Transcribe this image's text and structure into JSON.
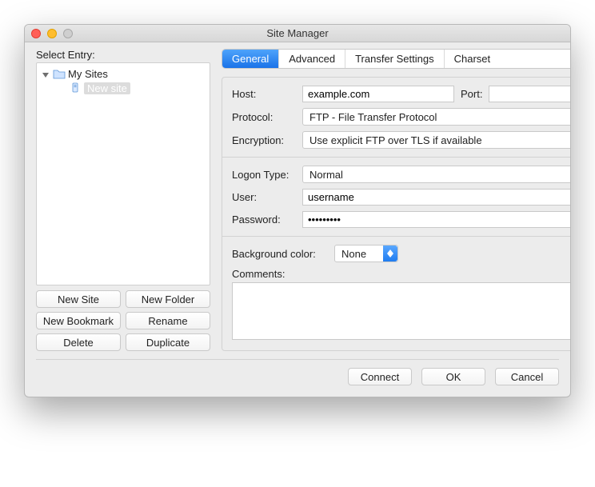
{
  "window_title": "Site Manager",
  "left": {
    "section_label": "Select Entry:",
    "root_label": "My Sites",
    "selected_label": "New site",
    "buttons": {
      "new_site": "New Site",
      "new_folder": "New Folder",
      "new_bookmark": "New Bookmark",
      "rename": "Rename",
      "delete": "Delete",
      "duplicate": "Duplicate"
    }
  },
  "tabs": {
    "general": "General",
    "advanced": "Advanced",
    "transfer": "Transfer Settings",
    "charset": "Charset"
  },
  "form": {
    "host_label": "Host:",
    "host_value": "example.com",
    "port_label": "Port:",
    "port_value": "",
    "protocol_label": "Protocol:",
    "protocol_value": "FTP - File Transfer Protocol",
    "encryption_label": "Encryption:",
    "encryption_value": "Use explicit FTP over TLS if available",
    "logon_label": "Logon Type:",
    "logon_value": "Normal",
    "user_label": "User:",
    "user_value": "username",
    "password_label": "Password:",
    "password_value": "•••••••••",
    "bgcolor_label": "Background color:",
    "bgcolor_value": "None",
    "comments_label": "Comments:"
  },
  "footer": {
    "connect": "Connect",
    "ok": "OK",
    "cancel": "Cancel"
  }
}
